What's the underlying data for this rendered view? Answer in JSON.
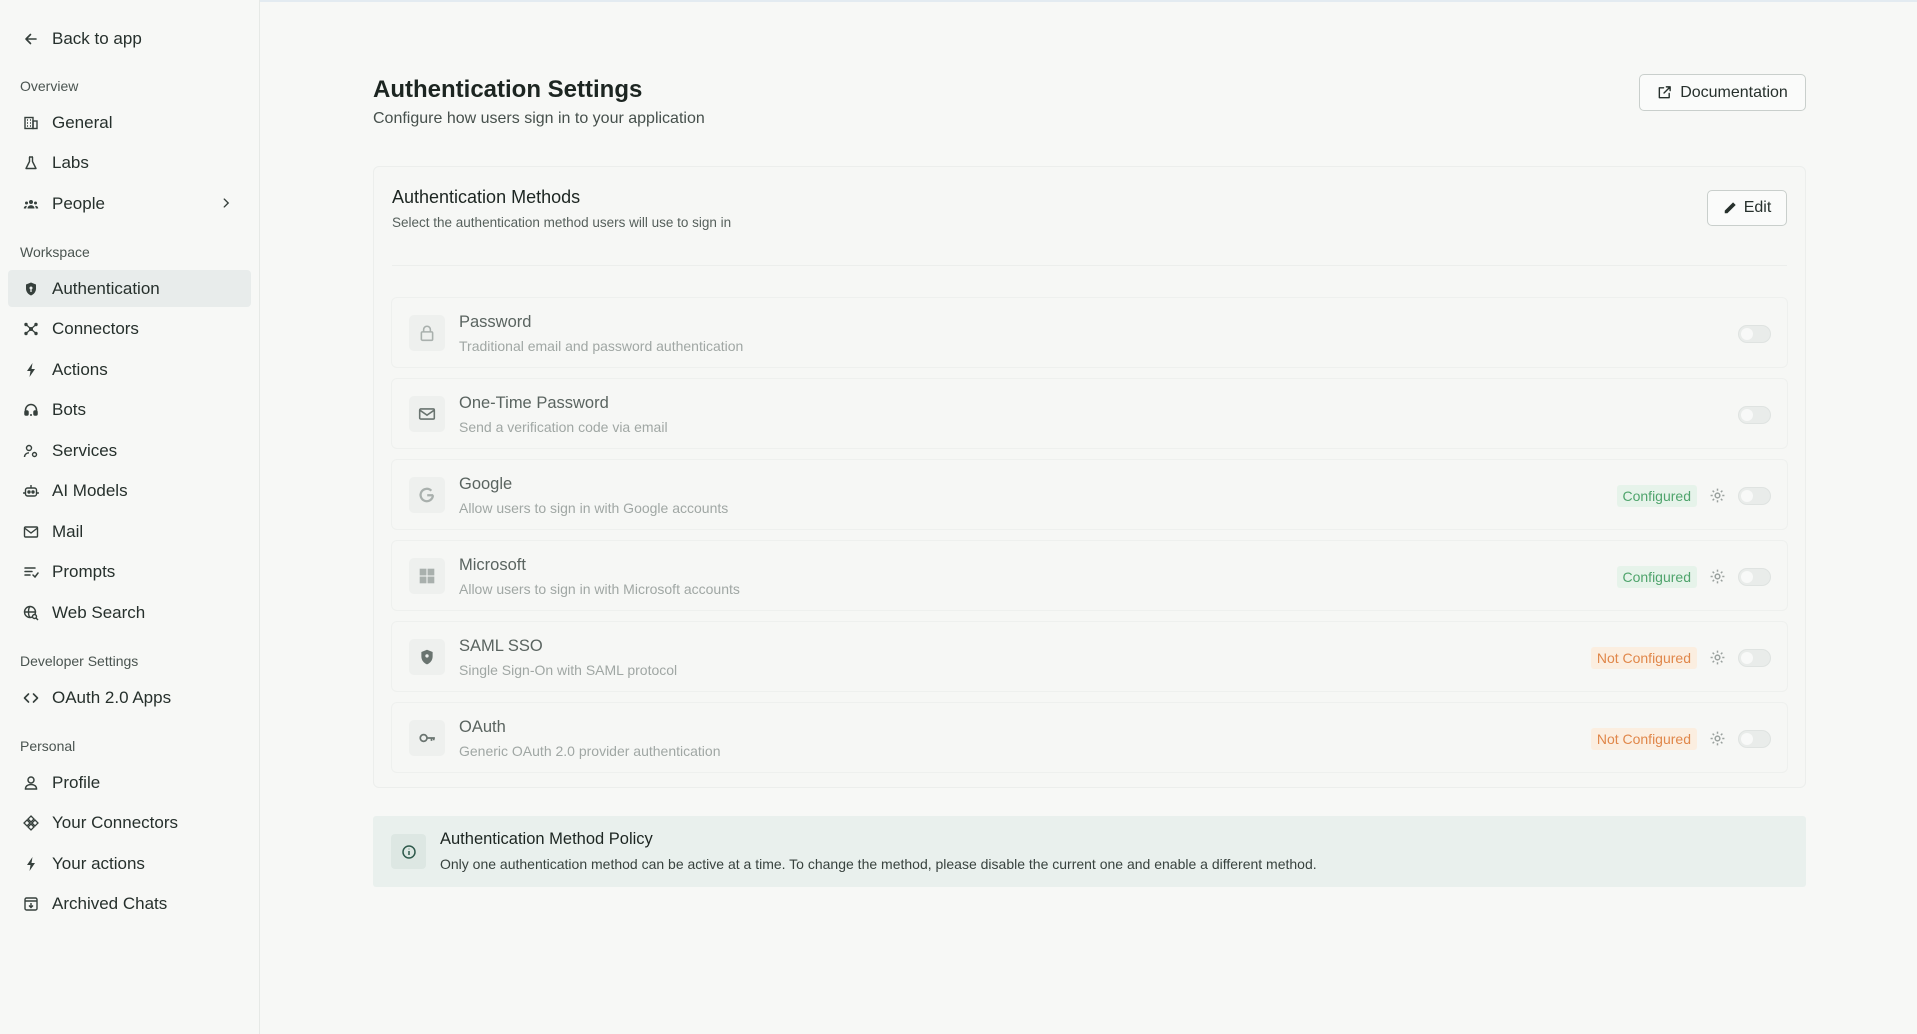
{
  "sidebar": {
    "back_label": "Back to app",
    "sections": {
      "overview": "Overview",
      "workspace": "Workspace",
      "developer": "Developer Settings",
      "personal": "Personal"
    },
    "items": {
      "general": "General",
      "labs": "Labs",
      "people": "People",
      "authentication": "Authentication",
      "connectors": "Connectors",
      "actions": "Actions",
      "bots": "Bots",
      "services": "Services",
      "ai_models": "AI Models",
      "mail": "Mail",
      "prompts": "Prompts",
      "web_search": "Web Search",
      "oauth_apps": "OAuth 2.0 Apps",
      "profile": "Profile",
      "your_connectors": "Your Connectors",
      "your_actions": "Your actions",
      "archived_chats": "Archived Chats"
    },
    "active_item": "authentication"
  },
  "header": {
    "title": "Authentication Settings",
    "subtitle": "Configure how users sign in to your application",
    "doc_button": "Documentation"
  },
  "card": {
    "title": "Authentication Methods",
    "subtitle": "Select the authentication method users will use to sign in",
    "edit_button": "Edit",
    "methods": [
      {
        "name": "Password",
        "desc": "Traditional email and password authentication",
        "status": "",
        "icon": "lock-icon",
        "enabled": false
      },
      {
        "name": "One-Time Password",
        "desc": "Send a verification code via email",
        "status": "",
        "icon": "mail-icon",
        "enabled": false
      },
      {
        "name": "Google",
        "desc": "Allow users to sign in with Google accounts",
        "status": "Configured",
        "icon": "google-icon",
        "enabled": false
      },
      {
        "name": "Microsoft",
        "desc": "Allow users to sign in with Microsoft accounts",
        "status": "Configured",
        "icon": "microsoft-icon",
        "enabled": false
      },
      {
        "name": "SAML SSO",
        "desc": "Single Sign-On with SAML protocol",
        "status": "Not Configured",
        "icon": "shield-icon",
        "enabled": false
      },
      {
        "name": "OAuth",
        "desc": "Generic OAuth 2.0 provider authentication",
        "status": "Not Configured",
        "icon": "key-icon",
        "enabled": false
      }
    ]
  },
  "policy": {
    "title": "Authentication Method Policy",
    "text": "Only one authentication method can be active at a time. To change the method, please disable the current one and enable a different method."
  },
  "colors": {
    "configured_text": "#4fa46c",
    "configured_bg": "#e6f3ea",
    "not_configured_text": "#e0874a",
    "not_configured_bg": "#fbeee0",
    "policy_bg": "#e9f0ed"
  }
}
